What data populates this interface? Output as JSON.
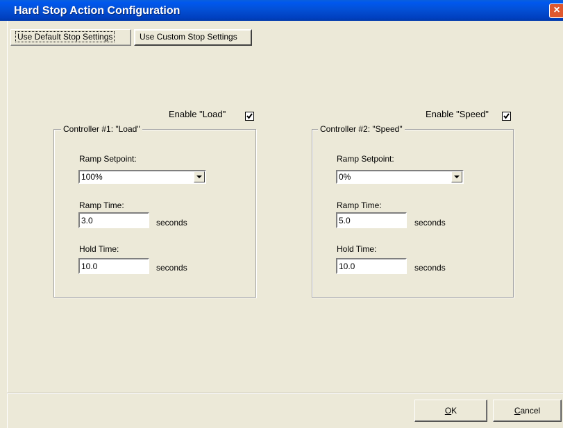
{
  "window": {
    "title": "Hard Stop Action Configuration",
    "close": "×"
  },
  "tabs": [
    {
      "label": "Use Default Stop Settings"
    },
    {
      "label": "Use Custom Stop Settings"
    }
  ],
  "controllers": [
    {
      "enable_label": "Enable \"Load\"",
      "enabled": true,
      "group_title": "Controller #1:  \"Load\"",
      "ramp_setpoint_label": "Ramp Setpoint:",
      "ramp_setpoint_value": "100%",
      "ramp_time_label": "Ramp Time:",
      "ramp_time_value": "3.0",
      "hold_time_label": "Hold Time:",
      "hold_time_value": "10.0",
      "unit": "seconds"
    },
    {
      "enable_label": "Enable \"Speed\"",
      "enabled": true,
      "group_title": "Controller #2:  \"Speed\"",
      "ramp_setpoint_label": "Ramp Setpoint:",
      "ramp_setpoint_value": "0%",
      "ramp_time_label": "Ramp Time:",
      "ramp_time_value": "5.0",
      "hold_time_label": "Hold Time:",
      "hold_time_value": "10.0",
      "unit": "seconds"
    }
  ],
  "buttons": {
    "ok": {
      "mnemonic": "O",
      "rest": "K"
    },
    "cancel": {
      "mnemonic": "C",
      "rest": "ancel"
    }
  },
  "colors": {
    "titlebar": "#0350d6",
    "face": "#ece9d8",
    "close": "#e0582e"
  }
}
